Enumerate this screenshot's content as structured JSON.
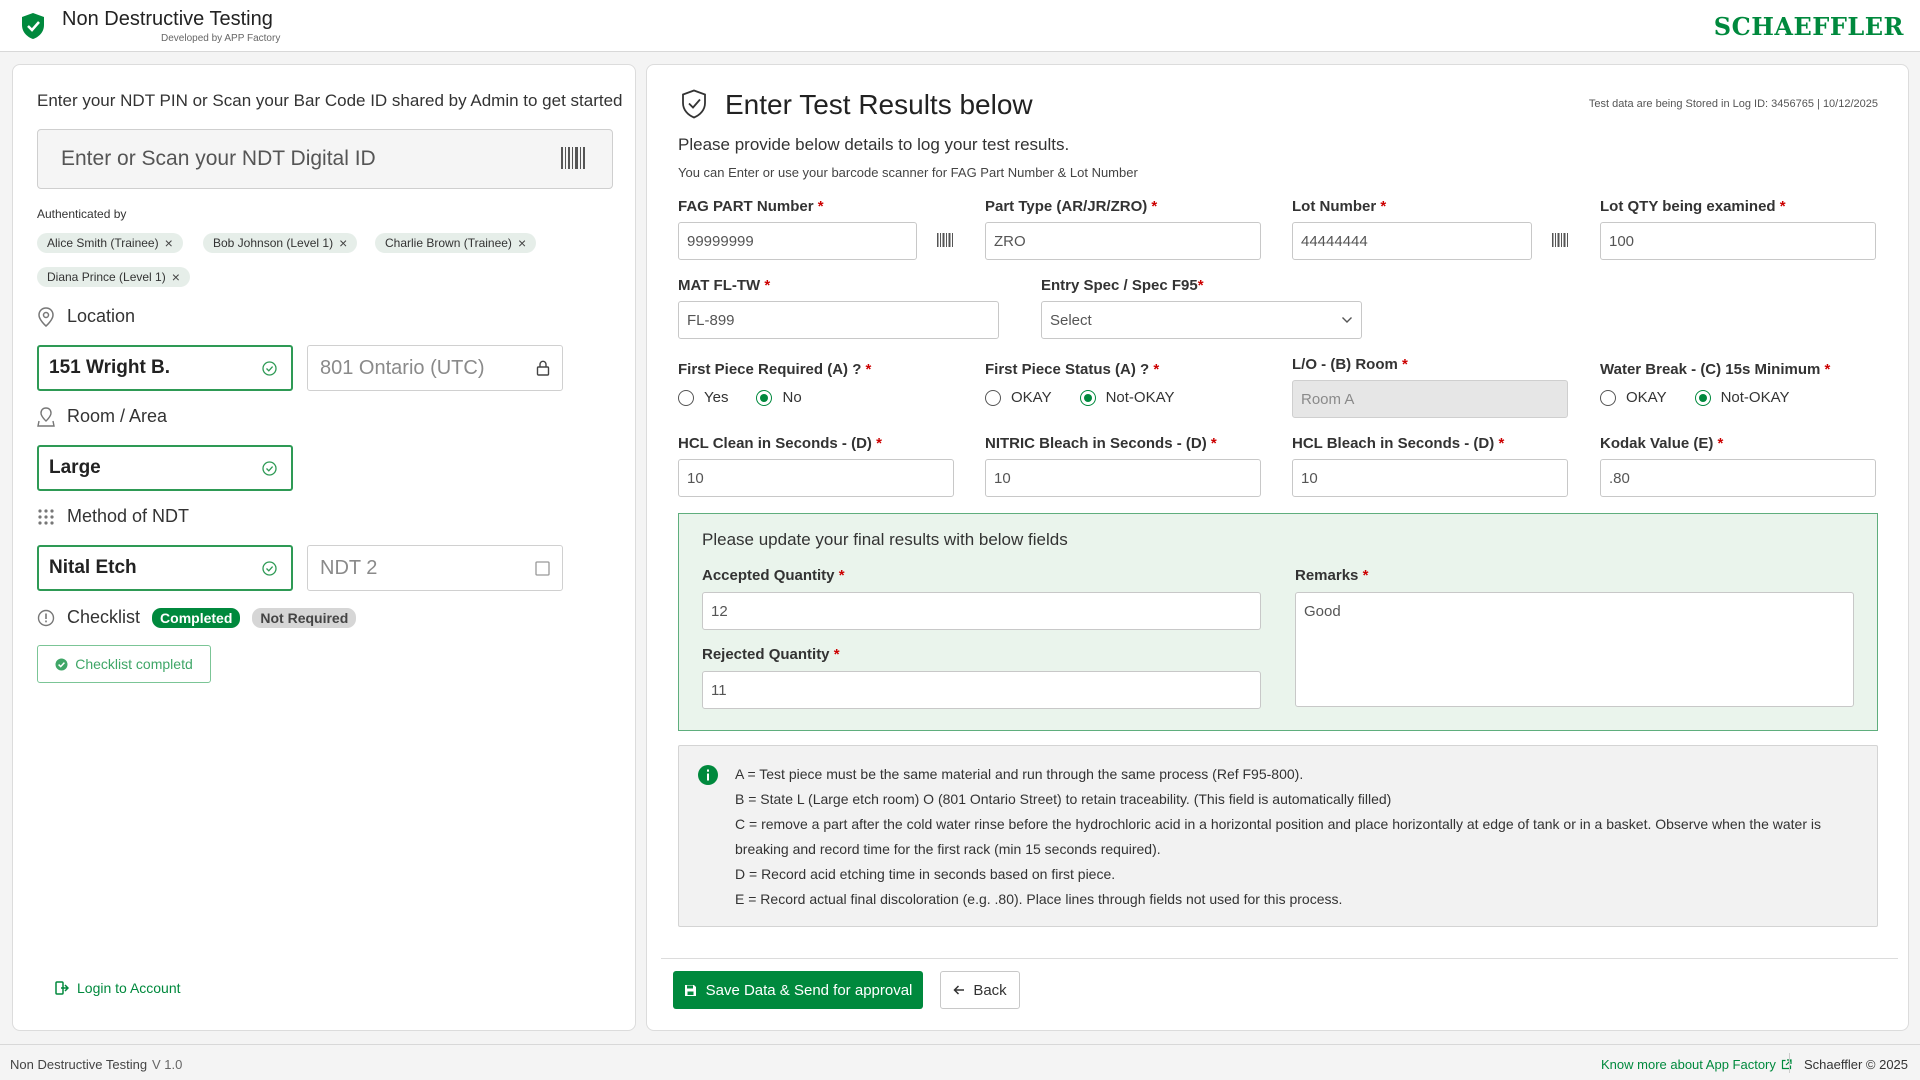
{
  "header": {
    "app_title": "Non Destructive Testing",
    "app_subtitle": "Developed by APP Factory",
    "brand": "SCHAEFFLER"
  },
  "left": {
    "intro": "Enter your NDT PIN or Scan your Bar Code ID shared by Admin to get started",
    "id_placeholder": "Enter or Scan your NDT Digital ID",
    "auth_label": "Authenticated by",
    "users": [
      "Alice Smith (Trainee)",
      "Bob Johnson (Level 1)",
      "Charlie Brown (Trainee)",
      "Diana Prince (Level 1)"
    ],
    "location_title": "Location",
    "location_selected": "151 Wright B.",
    "location_other": "801 Ontario (UTC)",
    "room_title": "Room / Area",
    "room_selected": "Large",
    "method_title": "Method of NDT",
    "method_selected": "Nital Etch",
    "method_other": "NDT 2",
    "checklist_title": "Checklist",
    "badge_completed": "Completed",
    "badge_not_required": "Not Required",
    "checklist_button": "Checklist completd",
    "login_link": "Login to Account"
  },
  "right": {
    "title": "Enter Test Results below",
    "log_info": "Test data are being Stored in Log ID: 3456765 | 10/12/2025",
    "description": "Please provide below details to log your test results.",
    "hint": "You can Enter or use your barcode scanner for FAG Part Number & Lot Number",
    "fields": {
      "fag_part": {
        "label": "FAG PART Number",
        "value": "99999999"
      },
      "part_type": {
        "label": "Part Type (AR/JR/ZRO)",
        "value": "ZRO"
      },
      "lot_number": {
        "label": "Lot Number",
        "value": "44444444"
      },
      "lot_qty": {
        "label": "Lot QTY being examined",
        "value": "100"
      },
      "mat_fl_tw": {
        "label": "MAT FL-TW",
        "value": "FL-899"
      },
      "entry_spec": {
        "label": "Entry Spec / Spec F95",
        "value": "Select"
      },
      "first_piece_req": {
        "label": "First Piece Required (A) ?",
        "opt1": "Yes",
        "opt2": "No"
      },
      "first_piece_status": {
        "label": "First Piece Status (A) ?",
        "opt1": "OKAY",
        "opt2": "Not-OKAY"
      },
      "lo_room": {
        "label": "L/O - (B) Room",
        "value": "Room A"
      },
      "water_break": {
        "label": "Water Break - (C) 15s Minimum",
        "opt1": "OKAY",
        "opt2": "Not-OKAY"
      },
      "hcl_clean": {
        "label": "HCL Clean in Seconds - (D)",
        "value": "10"
      },
      "nitric_bleach": {
        "label": "NITRIC Bleach in Seconds - (D)",
        "value": "10"
      },
      "hcl_bleach": {
        "label": "HCL Bleach in Seconds - (D)",
        "value": "10"
      },
      "kodak": {
        "label": "Kodak Value (E)",
        "value": ".80"
      }
    },
    "required_mark": "*",
    "final": {
      "title": "Please update your final results with below fields",
      "accepted_label": "Accepted Quantity",
      "accepted_value": "12",
      "rejected_label": "Rejected Quantity",
      "rejected_value": "11",
      "remarks_label": "Remarks",
      "remarks_value": "Good"
    },
    "info_lines": [
      "A = Test piece must be the same material and run through the same process (Ref F95-800).",
      "B = State L (Large etch room) O (801 Ontario Street) to retain traceability. (This field is automatically filled)",
      "C = remove a part after the cold water rinse before the hydrochloric acid in a horizontal position and place horizontally at edge of tank or in a basket. Observe when the water is breaking and record time for the first rack (min 15 seconds required).",
      "D = Record acid etching time in seconds based on first piece.",
      "E = Record actual final discoloration (e.g. .80). Place lines through fields not used for this process."
    ],
    "save_button": "Save Data & Send for approval",
    "back_button": "Back"
  },
  "footer": {
    "app_name": "Non Destructive Testing",
    "version": "V 1.0",
    "link": "Know more about App Factory",
    "copyright": "Schaeffler ©   2025"
  },
  "colors": {
    "accent": "#00893d",
    "required": "#cc0000",
    "final_bg": "#eaf4ec"
  },
  "icons": [
    "shield-check-icon",
    "barcode-icon",
    "close-icon",
    "location-pin-icon",
    "room-icon",
    "grid-dots-icon",
    "check-circle-icon",
    "lock-icon",
    "checkbox-icon",
    "info-circle-icon",
    "login-icon",
    "save-icon",
    "arrow-left-icon",
    "external-link-icon",
    "chevron-down-icon"
  ]
}
